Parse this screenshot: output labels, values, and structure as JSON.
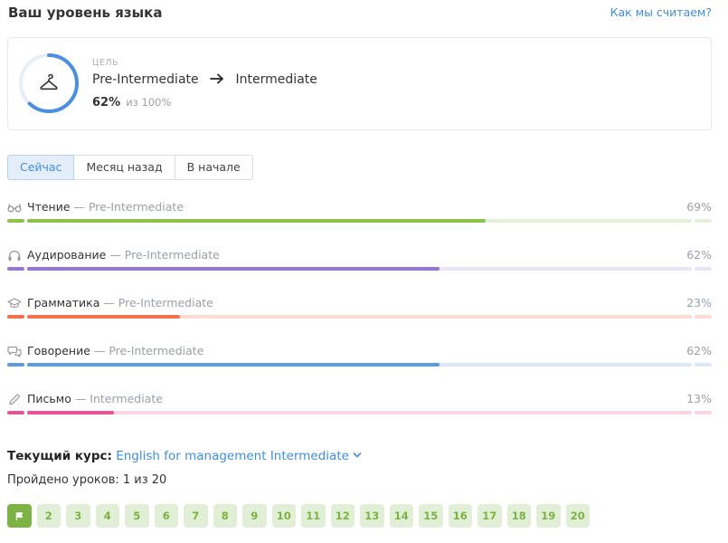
{
  "header": {
    "title": "Ваш уровень языка",
    "link": "Как мы считаем?"
  },
  "goal": {
    "label": "ЦЕЛЬ",
    "from_level": "Pre-Intermediate",
    "to_level": "Intermediate",
    "percent_text": "62%",
    "of_text": "из 100%",
    "progress": 0.62,
    "ring_color": "#4a90e2",
    "ring_track_color": "#e8eef6",
    "icon": "hanger-icon"
  },
  "tabs": [
    {
      "label": "Сейчас",
      "active": true
    },
    {
      "label": "Месяц назад",
      "active": false
    },
    {
      "label": "В начале",
      "active": false
    }
  ],
  "skills": [
    {
      "icon": "glasses-icon",
      "name": "Чтение",
      "level": " — Pre-Intermediate",
      "percent_text": "69%",
      "progress": 0.69,
      "color": "#8bc34a",
      "track": "#e4f1d8"
    },
    {
      "icon": "headphones-icon",
      "name": "Аудирование",
      "level": " — Pre-Intermediate",
      "percent_text": "62%",
      "progress": 0.62,
      "color": "#9575d8",
      "track": "#ebe3f8"
    },
    {
      "icon": "graduation-cap-icon",
      "name": "Грамматика",
      "level": " — Pre-Intermediate",
      "percent_text": "23%",
      "progress": 0.23,
      "color": "#f4714d",
      "track": "#fcdcd2"
    },
    {
      "icon": "speech-bubbles-icon",
      "name": "Говорение",
      "level": " — Pre-Intermediate",
      "percent_text": "62%",
      "progress": 0.62,
      "color": "#5b9be0",
      "track": "#dae8f8"
    },
    {
      "icon": "pencil-icon",
      "name": "Письмо",
      "level": " — Intermediate",
      "percent_text": "13%",
      "progress": 0.13,
      "color": "#e6559b",
      "track": "#f9d4e5"
    }
  ],
  "course": {
    "label": "Текущий курс:",
    "name": "English for management Intermediate",
    "lessons_text": "Пройдено уроков: 1 из 20"
  },
  "lessons": {
    "current_icon": "flag-icon",
    "numbers": [
      "2",
      "3",
      "4",
      "5",
      "6",
      "7",
      "8",
      "9",
      "10",
      "11",
      "12",
      "13",
      "14",
      "15",
      "16",
      "17",
      "18",
      "19",
      "20"
    ]
  }
}
